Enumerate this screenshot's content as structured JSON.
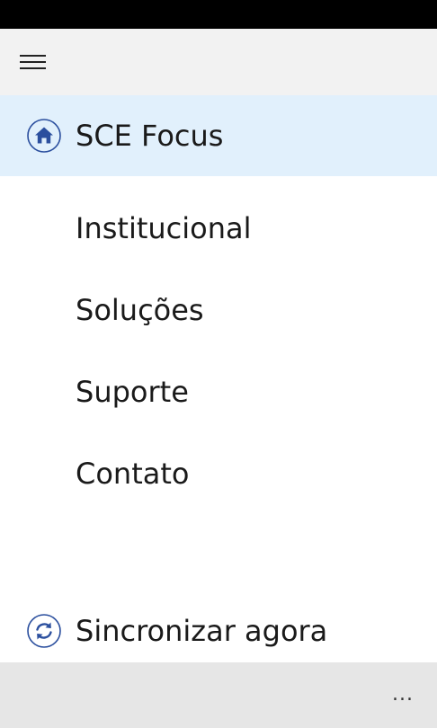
{
  "colors": {
    "status_bar": "#000000",
    "header_bg": "#f2f2f2",
    "selected_bg": "#e1f0fc",
    "icon_accent": "#2b4f9e",
    "app_bar_bg": "#e6e6e6",
    "text": "#1a1a1a"
  },
  "header": {
    "menu_icon": "hamburger-icon"
  },
  "nav": {
    "items": [
      {
        "label": "SCE Focus",
        "icon": "home-icon",
        "selected": true
      },
      {
        "label": "Institucional"
      },
      {
        "label": "Soluções"
      },
      {
        "label": "Suporte"
      },
      {
        "label": "Contato"
      }
    ],
    "sync": {
      "label": "Sincronizar agora",
      "icon": "sync-icon"
    }
  },
  "app_bar": {
    "more_label": "..."
  }
}
